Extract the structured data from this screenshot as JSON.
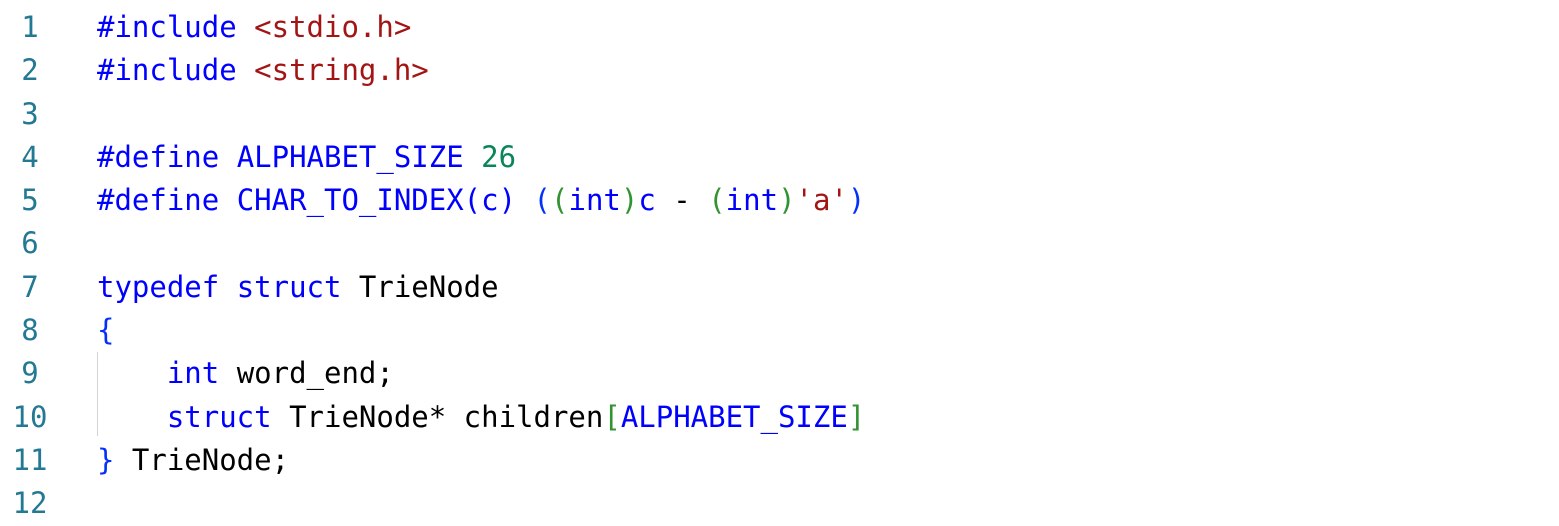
{
  "editor": {
    "colors": {
      "line_number": "#237893",
      "keyword": "#0000ff",
      "string": "#a31515",
      "number": "#098658",
      "bracket_level1": "#0431fa",
      "bracket_level2": "#319331",
      "text": "#000000"
    },
    "line_numbers": [
      "1",
      "2",
      "3",
      "4",
      "5",
      "6",
      "7",
      "8",
      "9",
      "10",
      "11",
      "12"
    ],
    "lines": {
      "l1": {
        "directive": "#include",
        "sp": " ",
        "header": "<stdio.h>"
      },
      "l2": {
        "directive": "#include",
        "sp": " ",
        "header": "<string.h>"
      },
      "l4": {
        "directive": "#define",
        "sp1": " ",
        "name": "ALPHABET_SIZE",
        "sp2": " ",
        "value": "26"
      },
      "l5": {
        "directive": "#define",
        "sp1": " ",
        "name": "CHAR_TO_INDEX",
        "p_open": "(",
        "param": "c",
        "p_close": ")",
        "sp2": " ",
        "outer_open": "(",
        "cast1_open": "(",
        "cast1_type": "int",
        "cast1_close": ")",
        "var": "c",
        "op": " - ",
        "cast2_open": "(",
        "cast2_type": "int",
        "cast2_close": ")",
        "char_lit": "'a'",
        "outer_close": ")"
      },
      "l7": {
        "kw1": "typedef",
        "sp1": " ",
        "kw2": "struct",
        "sp2": " ",
        "name": "TrieNode"
      },
      "l8": {
        "brace": "{"
      },
      "l9": {
        "indent": "    ",
        "type": "int",
        "rest": " word_end;"
      },
      "l10": {
        "indent": "    ",
        "kw": "struct",
        "rest": " TrieNode* children",
        "b_open": "[",
        "size": "ALPHABET_SIZE",
        "b_close": "]"
      },
      "l11": {
        "brace": "}",
        "rest": " TrieNode;"
      }
    }
  }
}
